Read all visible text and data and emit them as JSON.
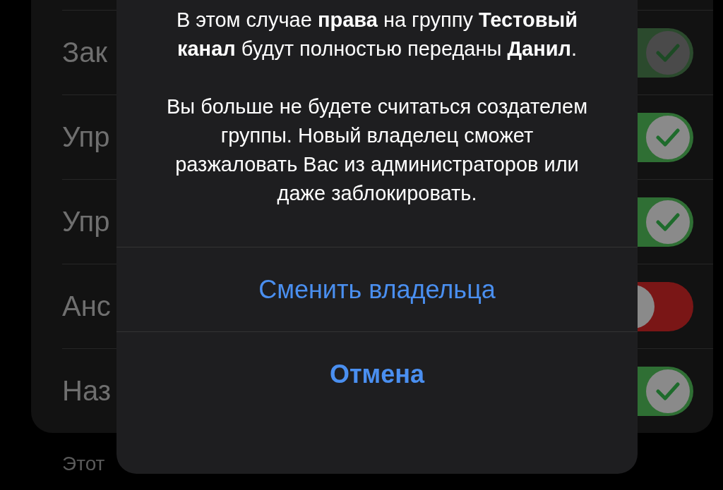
{
  "settings": {
    "rows": [
      {
        "label": "Зак",
        "on": true,
        "disabled": true
      },
      {
        "label": "Упр",
        "on": true,
        "disabled": false
      },
      {
        "label": "Упр",
        "on": true,
        "disabled": false
      },
      {
        "label": "Анс",
        "on": false,
        "disabled": false
      },
      {
        "label": "Наз",
        "on": true,
        "disabled": false
      }
    ],
    "footer": "Этот"
  },
  "alert": {
    "message": [
      "В этом случае **права** на группу **Тестовый канал** будут полностью переданы **Данил**.",
      "Вы больше не будете считаться создателем группы. Новый владелец сможет разжаловать Вас из администраторов или даже заблокировать."
    ],
    "actions": [
      {
        "label": "Сменить владельца",
        "kind": "default"
      },
      {
        "label": "Отмена",
        "kind": "cancel"
      }
    ]
  }
}
